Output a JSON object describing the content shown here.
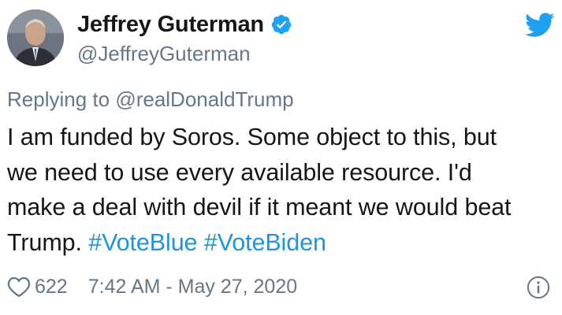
{
  "author": {
    "display_name": "Jeffrey Guterman",
    "handle": "@JeffreyGuterman",
    "verified": true
  },
  "reply": {
    "prefix": "Replying to",
    "mention": "@realDonaldTrump"
  },
  "tweet": {
    "lines": [
      "I am funded by Soros. Some object to this, but",
      "we need to use every available resource. I'd",
      "make a deal with devil if it meant we would beat"
    ],
    "last_line_text": "Trump.",
    "hashtags": [
      "#VoteBlue",
      "#VoteBiden"
    ]
  },
  "meta": {
    "like_count": "622",
    "timestamp": "7:42 AM - May 27, 2020"
  },
  "icons": {
    "logo": "twitter-bird-icon",
    "verified": "verified-badge-icon",
    "like": "heart-icon",
    "info": "info-icon"
  },
  "colors": {
    "brand": "#1da1f2",
    "hashtag": "#1b95e0",
    "secondary_text": "#657786",
    "primary_text": "#14171a"
  }
}
